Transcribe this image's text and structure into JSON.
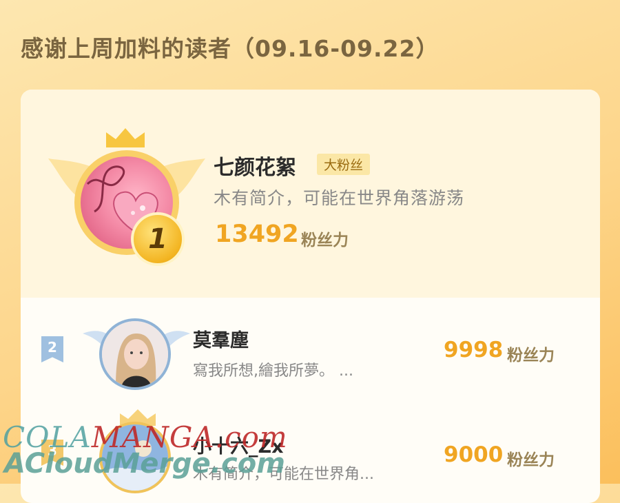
{
  "header": {
    "title": "感谢上周加料的读者（09.16-09.22）"
  },
  "top_reader": {
    "name": "七颜花絮",
    "badge": "大粉丝",
    "bio": "木有简介，可能在世界角落游荡",
    "fans": "13492",
    "fans_label": "粉丝力",
    "rank": "1"
  },
  "readers": [
    {
      "rank": "2",
      "name": "莫羣塵",
      "bio": "寫我所想,繪我所夢。 ...",
      "fans": "9998",
      "fans_label": "粉丝力"
    },
    {
      "rank": "3",
      "name": "小十六_Zx",
      "bio": "木有简介，可能在世界角...",
      "fans": "9000",
      "fans_label": "粉丝力"
    }
  ],
  "watermark": {
    "line1_a": "COLA",
    "line1_b": "MANGA",
    "line1_c": ".com",
    "line2": "ACloudMerge.com"
  },
  "colors": {
    "accent": "#f0a522",
    "badge_bg": "#fbe7a6",
    "rank2": "#9fc0e0"
  },
  "icons": {
    "crown": "crown-icon",
    "wings": "wing-icon",
    "medal": "medal-icon"
  }
}
